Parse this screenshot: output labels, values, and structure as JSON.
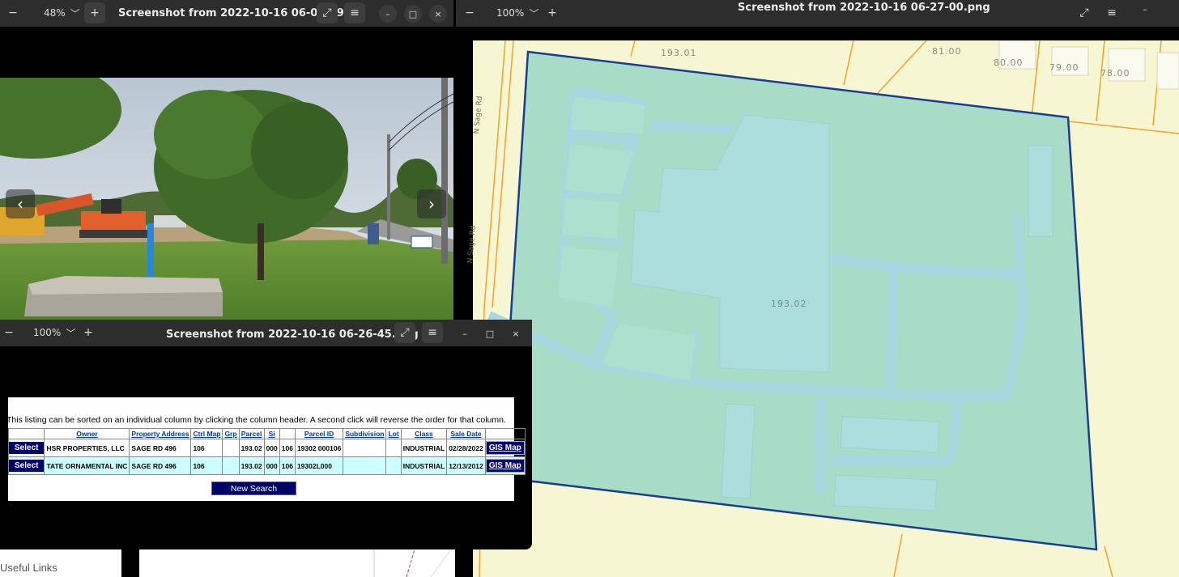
{
  "window_photo": {
    "zoom": "48%",
    "title": "Screenshot from 2022-10-16 06-08-09....",
    "prev": "‹",
    "next": "›"
  },
  "window_map": {
    "zoom": "100%",
    "title": "Screenshot from 2022-10-16 06-27-00.png",
    "labels": {
      "p19301": "193.01",
      "p81": "81.00",
      "p80": "80.00",
      "p79": "79.00",
      "p78": "78.00",
      "p19302": "193.02",
      "road1": "N Sage Rd",
      "road2": "N Sage Rd"
    }
  },
  "window_table": {
    "zoom": "100%",
    "title": "Screenshot from 2022-10-16 06-26-45.png",
    "note": "This listing can be sorted on an individual column by clicking the column header.  A second click will reverse the order for that column.",
    "headers": [
      "",
      "Owner",
      "Property Address",
      "Ctrl Map",
      "Grp",
      "Parcel",
      "Si",
      "",
      "Parcel ID",
      "Subdivision",
      "Lot",
      "Class",
      "Sale Date",
      ""
    ],
    "rows": [
      [
        "Select",
        "HSR PROPERTIES, LLC",
        "SAGE RD 496",
        "106",
        "",
        "193.02",
        "000",
        "106",
        "19302 000106",
        "",
        "",
        "INDUSTRIAL",
        "02/28/2022",
        "GIS Map"
      ],
      [
        "Select",
        "TATE ORNAMENTAL INC",
        "SAGE RD 496",
        "106",
        "",
        "193.02",
        "000",
        "106",
        "19302L000",
        "",
        "",
        "INDUSTRIAL",
        "12/13/2012",
        "GIS Map"
      ]
    ],
    "new_search": "New Search"
  },
  "bottom": {
    "useful_links": "Useful Links"
  },
  "icons": {
    "zoom_out": "−",
    "zoom_in": "+",
    "fullscreen": "⤢",
    "menu": "≡",
    "minimize": "–",
    "maximize": "□",
    "close": "×"
  },
  "colors": {
    "header_bg": "#2d2d2d",
    "parcel_fill": "#a8dcc7",
    "parcel_border": "#1a3d8f",
    "map_bg": "#f7f6d2",
    "table_button": "#000066"
  }
}
